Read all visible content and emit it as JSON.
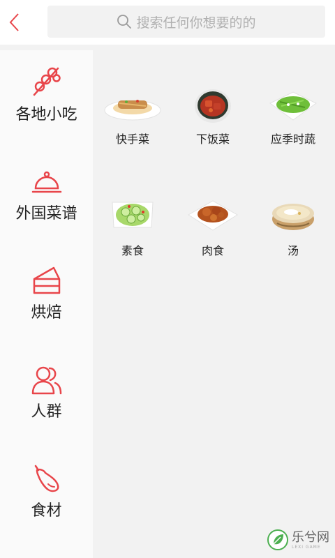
{
  "header": {
    "back_icon": "chevron-left-icon",
    "search": {
      "icon": "search-icon",
      "placeholder": "搜索任何你想要的的"
    }
  },
  "sidebar": {
    "items": [
      {
        "label": "各地小吃",
        "icon": "skewer-icon"
      },
      {
        "label": "外国菜谱",
        "icon": "cloche-icon"
      },
      {
        "label": "烘焙",
        "icon": "cake-slice-icon"
      },
      {
        "label": "人群",
        "icon": "people-icon"
      },
      {
        "label": "食材",
        "icon": "eggplant-icon"
      }
    ]
  },
  "content": {
    "items": [
      {
        "label": "快手菜"
      },
      {
        "label": "下饭菜"
      },
      {
        "label": "应季时蔬"
      },
      {
        "label": "素食"
      },
      {
        "label": "肉食"
      },
      {
        "label": "汤"
      }
    ]
  },
  "watermark": {
    "title": "乐兮网",
    "subtitle": "LEXI GAME"
  },
  "colors": {
    "accent": "#e8454a",
    "sidebar_bg": "#fafafa",
    "content_bg": "#f2f2f2"
  }
}
